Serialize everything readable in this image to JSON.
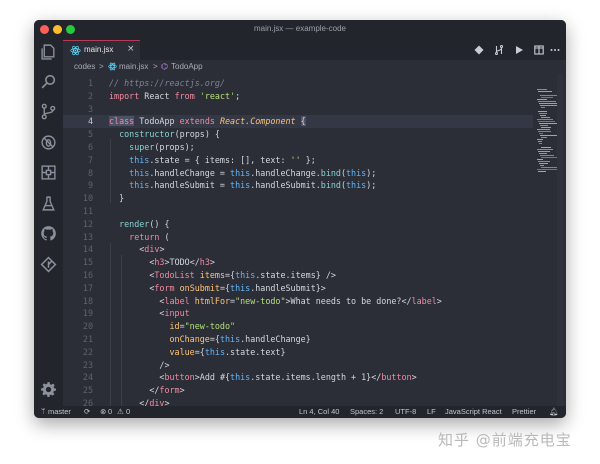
{
  "window": {
    "title": "main.jsx — example-code"
  },
  "activity_bar": {
    "icons": [
      "files-icon",
      "search-icon",
      "source-control-icon",
      "debug-icon",
      "extensions-icon",
      "flask-icon",
      "github-icon",
      "git-icon",
      "settings-gear-icon"
    ]
  },
  "tabs": [
    {
      "label": "main.jsx",
      "active": true,
      "icon": "react-icon"
    }
  ],
  "breadcrumb": {
    "folder": "codes",
    "sep": ">",
    "file": "main.jsx",
    "symbol": "TodoApp"
  },
  "editor": {
    "active_line": 4,
    "lines": [
      {
        "n": "1",
        "t": [
          [
            "t-comment",
            "// https://reactjs.org/"
          ]
        ]
      },
      {
        "n": "2",
        "t": [
          [
            "t-kw",
            "import "
          ],
          [
            "t-plain",
            "React "
          ],
          [
            "t-kw",
            "from "
          ],
          [
            "t-str",
            "'react'"
          ],
          [
            "t-plain",
            ";"
          ]
        ]
      },
      {
        "n": "3",
        "t": []
      },
      {
        "n": "4",
        "t": [
          [
            "t-kw t-hl",
            "class"
          ],
          [
            "t-plain",
            " TodoApp "
          ],
          [
            "t-kw",
            "extends "
          ],
          [
            "t-type",
            "React.Component"
          ],
          [
            "t-plain",
            " "
          ],
          [
            "t-plain t-hl",
            "{"
          ]
        ]
      },
      {
        "n": "5",
        "t": [
          [
            "t-plain",
            "  "
          ],
          [
            "t-fn",
            "constructor"
          ],
          [
            "t-plain",
            "(props) {"
          ]
        ]
      },
      {
        "n": "6",
        "t": [
          [
            "t-plain",
            "    "
          ],
          [
            "t-fn",
            "super"
          ],
          [
            "t-plain",
            "(props);"
          ]
        ]
      },
      {
        "n": "7",
        "t": [
          [
            "t-this",
            "    this"
          ],
          [
            "t-plain",
            ".state = { items: [], text: "
          ],
          [
            "t-str",
            "''"
          ],
          [
            "t-plain",
            " };"
          ]
        ]
      },
      {
        "n": "8",
        "t": [
          [
            "t-this",
            "    this"
          ],
          [
            "t-plain",
            ".handleChange = "
          ],
          [
            "t-this",
            "this"
          ],
          [
            "t-plain",
            ".handleChange."
          ],
          [
            "t-fn",
            "bind"
          ],
          [
            "t-plain",
            "("
          ],
          [
            "t-this",
            "this"
          ],
          [
            "t-plain",
            ");"
          ]
        ]
      },
      {
        "n": "9",
        "t": [
          [
            "t-this",
            "    this"
          ],
          [
            "t-plain",
            ".handleSubmit = "
          ],
          [
            "t-this",
            "this"
          ],
          [
            "t-plain",
            ".handleSubmit."
          ],
          [
            "t-fn",
            "bind"
          ],
          [
            "t-plain",
            "("
          ],
          [
            "t-this",
            "this"
          ],
          [
            "t-plain",
            ");"
          ]
        ]
      },
      {
        "n": "10",
        "t": [
          [
            "t-plain",
            "  }"
          ]
        ]
      },
      {
        "n": "11",
        "t": []
      },
      {
        "n": "12",
        "t": [
          [
            "t-plain",
            "  "
          ],
          [
            "t-fn",
            "render"
          ],
          [
            "t-plain",
            "() {"
          ]
        ]
      },
      {
        "n": "13",
        "t": [
          [
            "t-kw",
            "    return "
          ],
          [
            "t-plain",
            "("
          ]
        ]
      },
      {
        "n": "14",
        "t": [
          [
            "t-plain",
            "      <"
          ],
          [
            "t-tag",
            "div"
          ],
          [
            "t-plain",
            ">"
          ]
        ]
      },
      {
        "n": "15",
        "t": [
          [
            "t-plain",
            "        <"
          ],
          [
            "t-tag",
            "h3"
          ],
          [
            "t-plain",
            ">TODO</"
          ],
          [
            "t-tag",
            "h3"
          ],
          [
            "t-plain",
            ">"
          ]
        ]
      },
      {
        "n": "16",
        "t": [
          [
            "t-plain",
            "        <"
          ],
          [
            "t-tag",
            "TodoList "
          ],
          [
            "t-attr",
            "items"
          ],
          [
            "t-plain",
            "={"
          ],
          [
            "t-this",
            "this"
          ],
          [
            "t-plain",
            ".state.items} />"
          ]
        ]
      },
      {
        "n": "17",
        "t": [
          [
            "t-plain",
            "        <"
          ],
          [
            "t-tag",
            "form "
          ],
          [
            "t-attr",
            "onSubmit"
          ],
          [
            "t-plain",
            "={"
          ],
          [
            "t-this",
            "this"
          ],
          [
            "t-plain",
            ".handleSubmit}>"
          ]
        ]
      },
      {
        "n": "18",
        "t": [
          [
            "t-plain",
            "          <"
          ],
          [
            "t-tag",
            "label "
          ],
          [
            "t-attr",
            "htmlFor"
          ],
          [
            "t-plain",
            "="
          ],
          [
            "t-str",
            "\"new-todo\""
          ],
          [
            "t-plain",
            ">What needs to be done?</"
          ],
          [
            "t-tag",
            "label"
          ],
          [
            "t-plain",
            ">"
          ]
        ]
      },
      {
        "n": "19",
        "t": [
          [
            "t-plain",
            "          <"
          ],
          [
            "t-tag",
            "input"
          ]
        ]
      },
      {
        "n": "20",
        "t": [
          [
            "t-attr",
            "            id"
          ],
          [
            "t-plain",
            "="
          ],
          [
            "t-str",
            "\"new-todo\""
          ]
        ]
      },
      {
        "n": "21",
        "t": [
          [
            "t-attr",
            "            onChange"
          ],
          [
            "t-plain",
            "={"
          ],
          [
            "t-this",
            "this"
          ],
          [
            "t-plain",
            ".handleChange}"
          ]
        ]
      },
      {
        "n": "22",
        "t": [
          [
            "t-attr",
            "            value"
          ],
          [
            "t-plain",
            "={"
          ],
          [
            "t-this",
            "this"
          ],
          [
            "t-plain",
            ".state.text}"
          ]
        ]
      },
      {
        "n": "23",
        "t": [
          [
            "t-plain",
            "          />"
          ]
        ]
      },
      {
        "n": "24",
        "t": [
          [
            "t-plain",
            "          <"
          ],
          [
            "t-tag",
            "button"
          ],
          [
            "t-plain",
            ">Add #{"
          ],
          [
            "t-this",
            "this"
          ],
          [
            "t-plain",
            ".state.items.length + 1}</"
          ],
          [
            "t-tag",
            "button"
          ],
          [
            "t-plain",
            ">"
          ]
        ]
      },
      {
        "n": "25",
        "t": [
          [
            "t-plain",
            "        </"
          ],
          [
            "t-tag",
            "form"
          ],
          [
            "t-plain",
            ">"
          ]
        ]
      },
      {
        "n": "26",
        "t": [
          [
            "t-plain",
            "      </"
          ],
          [
            "t-tag",
            "div"
          ],
          [
            "t-plain",
            ">"
          ]
        ]
      }
    ]
  },
  "status_bar": {
    "branch": "master",
    "sync_icon": "sync-icon",
    "errors": "0",
    "warnings": "0",
    "position": "Ln 4, Col 40",
    "spaces": "Spaces: 2",
    "encoding": "UTF-8",
    "eol": "LF",
    "language": "JavaScript React",
    "formatter": "Prettier"
  },
  "watermark": "知乎 @前端充电宝",
  "colors": {
    "keyword": "#f38ba0",
    "string": "#b5e07a",
    "function": "#8ad4d3",
    "this": "#64b5f6",
    "type": "#ffc47a",
    "active_tab_border": "#b53b56"
  }
}
